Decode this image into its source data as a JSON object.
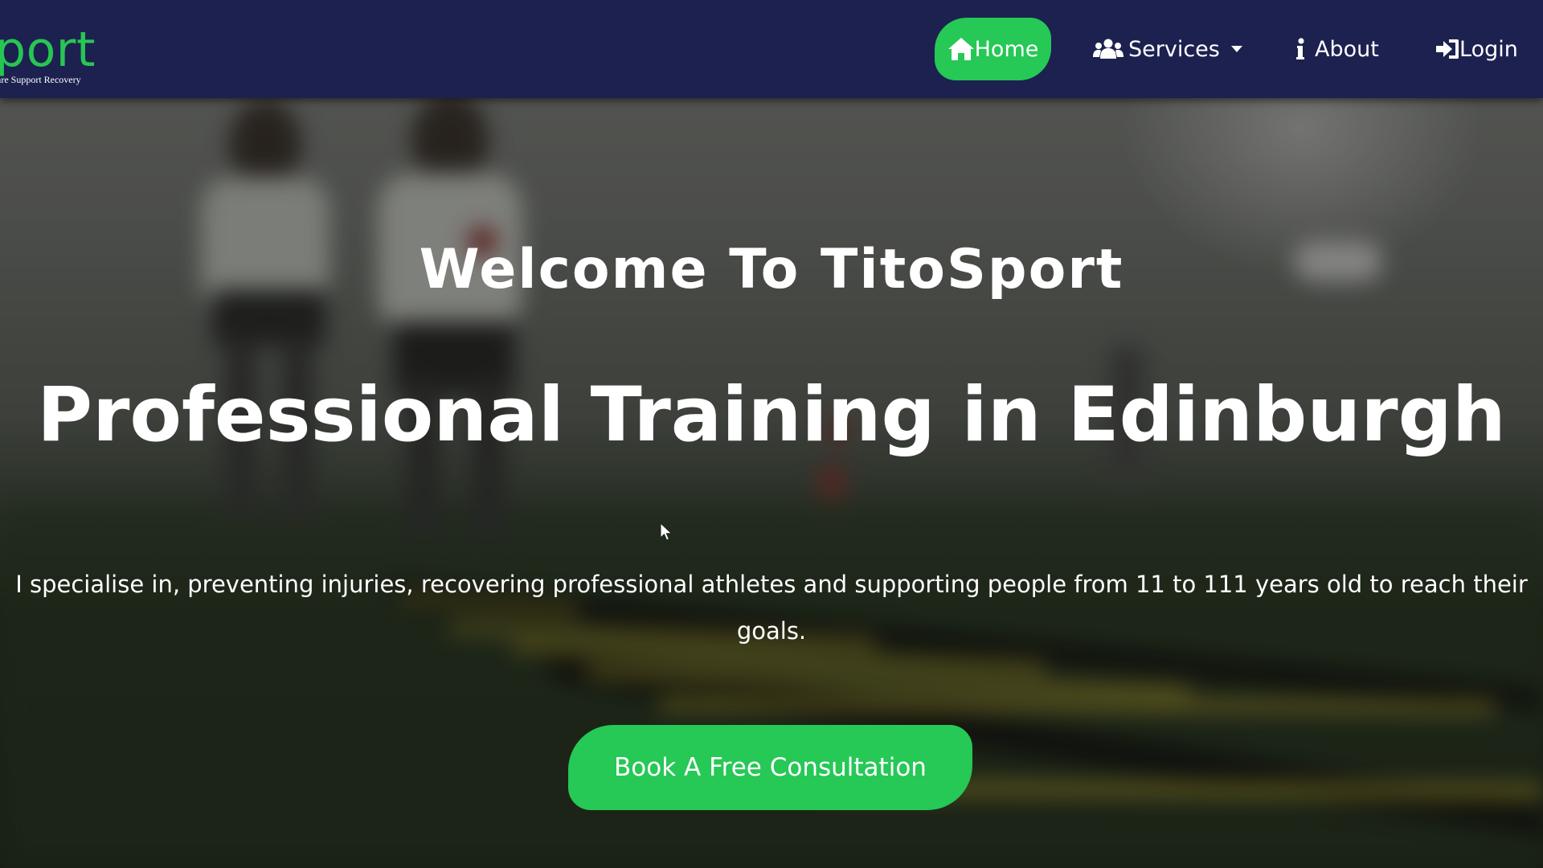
{
  "brand": {
    "name": "port",
    "tagline": "are Support Recovery"
  },
  "nav": {
    "home": "Home",
    "services": "Services",
    "about": "About",
    "login": "Login"
  },
  "hero": {
    "welcome": "Welcome To TitoSport",
    "headline": "Professional Training in Edinburgh",
    "intro": "I specialise in, preventing injuries, recovering professional athletes and supporting people from 11 to 111 years old to reach their goals.",
    "cta_label": "Book A Free Consultation"
  },
  "colors": {
    "navbar": "#1c2150",
    "accent_green": "#26c856",
    "text": "#ffffff"
  },
  "icons": [
    "home-icon",
    "users-icon",
    "caret-down-icon",
    "info-icon",
    "sign-in-icon",
    "mouse-cursor-icon"
  ]
}
